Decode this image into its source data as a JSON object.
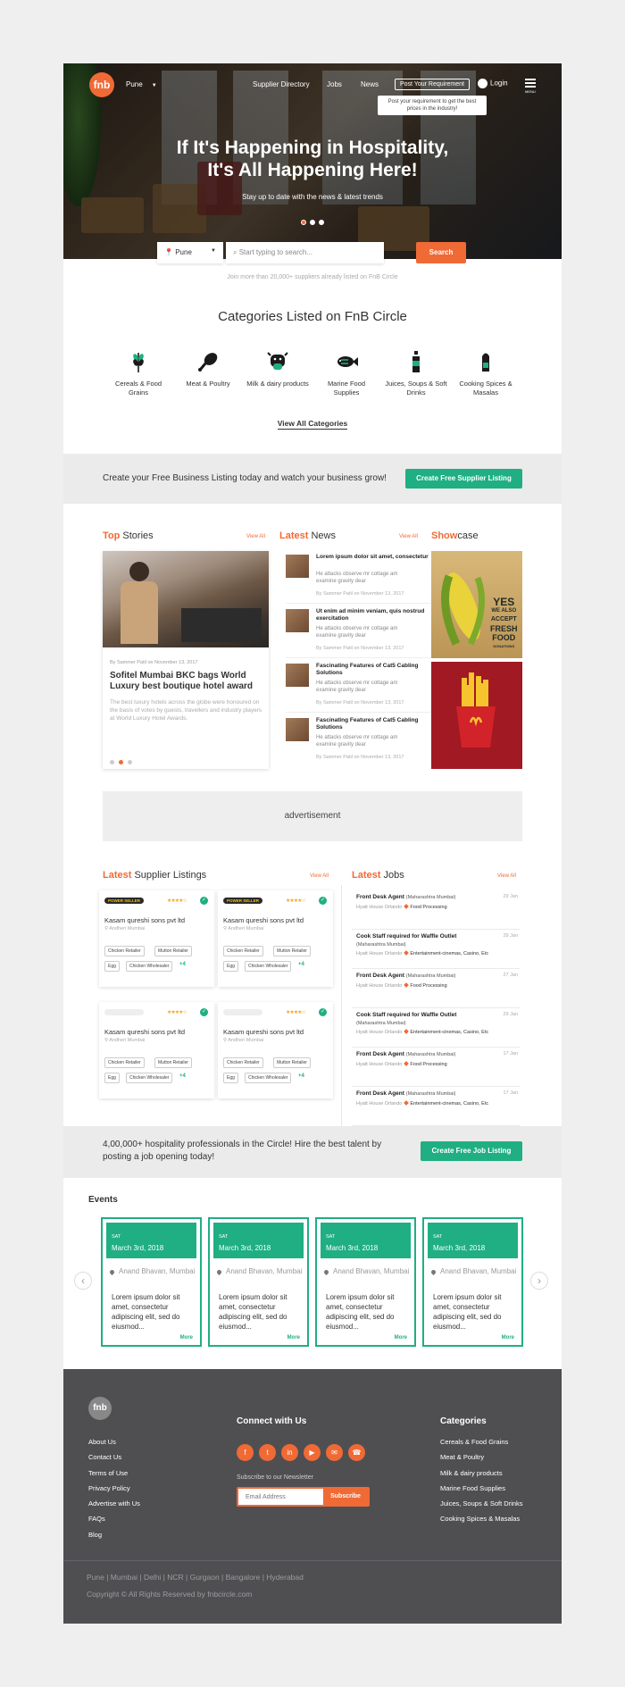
{
  "header": {
    "logo_text": "fnb",
    "city": "Pune",
    "nav": [
      "Supplier Directory",
      "Jobs",
      "News"
    ],
    "post_button": "Post Your Requirement",
    "login": "Login",
    "menu_label": "MENU",
    "tooltip": "Post your requirement to get the best prices in the industry!"
  },
  "hero": {
    "headline_line1": "If It's Happening in Hospitality,",
    "headline_line2": "It's All Happening Here!",
    "tagline": "Stay up to date with the news & latest trends",
    "active_slide": 1,
    "slide_count": 3
  },
  "search": {
    "city": "Pune",
    "placeholder": "Start typing to search...",
    "button": "Search",
    "join_note": "Join more than 20,000+ suppliers already listed on FnB Circle"
  },
  "categories": {
    "title": "Categories Listed on FnB Circle",
    "items": [
      {
        "label": "Cereals & Food Grains",
        "icon": "wheat-icon"
      },
      {
        "label": "Meat & Poultry",
        "icon": "drumstick-icon"
      },
      {
        "label": "Milk & dairy products",
        "icon": "cow-icon"
      },
      {
        "label": "Marine Food Supplies",
        "icon": "fish-icon"
      },
      {
        "label": "Juices, Soups & Soft Drinks",
        "icon": "bottle-icon"
      },
      {
        "label": "Cooking Spices & Masalas",
        "icon": "spice-jar-icon"
      }
    ],
    "view_all": "View All Categories"
  },
  "listing_cta": {
    "text": "Create your Free Business Listing today and watch your business grow!",
    "button": "Create Free Supplier Listing"
  },
  "stories": {
    "title_accent": "Top",
    "title_rest": "Stories",
    "view_all": "View All",
    "meta": "By Sammer Patil on November 13, 2017",
    "headline": "Sofitel Mumbai BKC bags World Luxury best boutique hotel award",
    "desc": "The best luxury hotels across the globe were honoured on the basis of votes by guests, travellers and industry players at World Luxury Hotel Awards."
  },
  "news": {
    "title_accent": "Latest",
    "title_rest": "News",
    "view_all": "View All",
    "items": [
      {
        "title": "Lorem ipsum dolor sit amet, consectetur",
        "desc": "He attacks observe mr cottage am examine gravity dear",
        "meta": "By Sammer Patil on November 13, 2017"
      },
      {
        "title": "Ut enim ad minim veniam, quis nostrud exercitation",
        "desc": "He attacks observe mr cottage am examine gravity dear",
        "meta": "By Sammer Patil on November 13, 2017"
      },
      {
        "title": "Fascinating Features of Cat5 Cabling Solutions",
        "desc": "He attacks observe mr cottage am examine gravity dear",
        "meta": "By Sammer Patil on November 13, 2017"
      },
      {
        "title": "Fascinating Features of Cat5 Cabling Solutions",
        "desc": "He attacks observe mr cottage am examine gravity dear",
        "meta": "By Sammer Patil on November 13, 2017"
      }
    ]
  },
  "showcase": {
    "title_accent": "Show",
    "title_rest": "case",
    "ad1_text": [
      "YES",
      "WE ALSO",
      "ACCEPT",
      "FRESH",
      "FOOD",
      "DONATIONS"
    ]
  },
  "advertisement": "advertisement",
  "suppliers": {
    "title_accent": "Latest",
    "title_rest": "Supplier Listings",
    "view_all": "View All",
    "badge": "POWER SELLER",
    "stars": "★★★★☆",
    "items": [
      {
        "name": "Kasam qureshi sons pvt ltd",
        "location": "Andheri Mumbai",
        "chips": [
          "Chicken Retailer",
          "Mutton Retailer",
          "Egg",
          "Chicken Wholesaler"
        ],
        "more": "+4",
        "power": true
      },
      {
        "name": "Kasam qureshi sons pvt ltd",
        "location": "Andheri Mumbai",
        "chips": [
          "Chicken Retailer",
          "Mutton Retailer",
          "Egg",
          "Chicken Wholesaler"
        ],
        "more": "+4",
        "power": true
      },
      {
        "name": "Kasam qureshi sons pvt ltd",
        "location": "Andheri Mumbai",
        "chips": [
          "Chicken Retailer",
          "Mutton Retailer",
          "Egg",
          "Chicken Wholesaler"
        ],
        "more": "+4",
        "power": false
      },
      {
        "name": "Kasam qureshi sons pvt ltd",
        "location": "Andheri Mumbai",
        "chips": [
          "Chicken Retailer",
          "Mutton Retailer",
          "Egg",
          "Chicken Wholesaler"
        ],
        "more": "+4",
        "power": false
      }
    ]
  },
  "jobs": {
    "title_accent": "Latest",
    "title_rest": "Jobs",
    "view_all": "View All",
    "items": [
      {
        "title": "Front Desk Agent",
        "loc": "(Maharashtra Mumbai)",
        "date": "29 Jan",
        "company": "Hyatt House Orlando",
        "category": "Food Processing"
      },
      {
        "title": "Cook Staff required for Waffle Outlet",
        "loc": "(Maharashtra Mumbai)",
        "date": "29 Jan",
        "company": "Hyatt House Orlando",
        "category": "Entertainment-cinemas, Casino, Etc"
      },
      {
        "title": "Front Desk Agent",
        "loc": "(Maharashtra Mumbai)",
        "date": "27 Jan",
        "company": "Hyatt House Orlando",
        "category": "Food Processing"
      },
      {
        "title": "Cook Staff required for Waffle Outlet",
        "loc": "(Maharashtra Mumbai)",
        "date": "29 Jan",
        "company": "Hyatt House Orlando",
        "category": "Entertainment-cinemas, Casino, Etc"
      },
      {
        "title": "Front Desk Agent",
        "loc": "(Maharashtra Mumbai)",
        "date": "17 Jan",
        "company": "Hyatt House Orlando",
        "category": "Food Processing"
      },
      {
        "title": "Front Desk Agent",
        "loc": "(Maharashtra Mumbai)",
        "date": "17 Jan",
        "company": "Hyatt House Orlando",
        "category": "Entertainment-cinemas, Casino, Etc"
      }
    ]
  },
  "job_cta": {
    "text": "4,00,000+ hospitality professionals in the Circle! Hire the best talent by posting a job opening today!",
    "button": "Create Free Job Listing"
  },
  "events": {
    "title": "Events",
    "items": [
      {
        "day": "SAT",
        "date": "March 3rd, 2018",
        "location": "Anand Bhavan, Mumbai",
        "desc": "Lorem ipsum dolor sit amet, consectetur adipiscing elit, sed do eiusmod...",
        "more": "More"
      },
      {
        "day": "SAT",
        "date": "March 3rd, 2018",
        "location": "Anand Bhavan, Mumbai",
        "desc": "Lorem ipsum dolor sit amet, consectetur adipiscing elit, sed do eiusmod...",
        "more": "More"
      },
      {
        "day": "SAT",
        "date": "March 3rd, 2018",
        "location": "Anand Bhavan, Mumbai",
        "desc": "Lorem ipsum dolor sit amet, consectetur adipiscing elit, sed do eiusmod...",
        "more": "More"
      },
      {
        "day": "SAT",
        "date": "March 3rd, 2018",
        "location": "Anand Bhavan, Mumbai",
        "desc": "Lorem ipsum dolor sit amet, consectetur adipiscing elit, sed do eiusmod...",
        "more": "More"
      }
    ]
  },
  "footer": {
    "logo_text": "fnb",
    "links": [
      "About Us",
      "Contact Us",
      "Terms of Use",
      "Privacy Policy",
      "Advertise with Us",
      "FAQs",
      "Blog"
    ],
    "connect_title": "Connect with Us",
    "social": [
      "facebook-icon",
      "twitter-icon",
      "linkedin-icon",
      "youtube-icon",
      "mail-icon",
      "phone-icon"
    ],
    "newsletter_label": "Subscribe to our Newsletter",
    "email_placeholder": "Email Address",
    "subscribe": "Subscribe",
    "categories_title": "Categories",
    "categories": [
      "Cereals & Food Grains",
      "Meat & Poultry",
      "Milk & dairy products",
      "Marine Food Supplies",
      "Juices, Soups & Soft Drinks",
      "Cooking Spices & Masalas"
    ],
    "cities": "Pune | Mumbai | Delhi | NCR | Gurgaon | Bangalore | Hyderabad",
    "copyright": "Copyright © All Rights Reserved by fnbcircle.com"
  },
  "colors": {
    "accent": "#f06a35",
    "green": "#1faf82",
    "footer_bg": "#4f4f52",
    "page_bg": "#efeff0"
  }
}
